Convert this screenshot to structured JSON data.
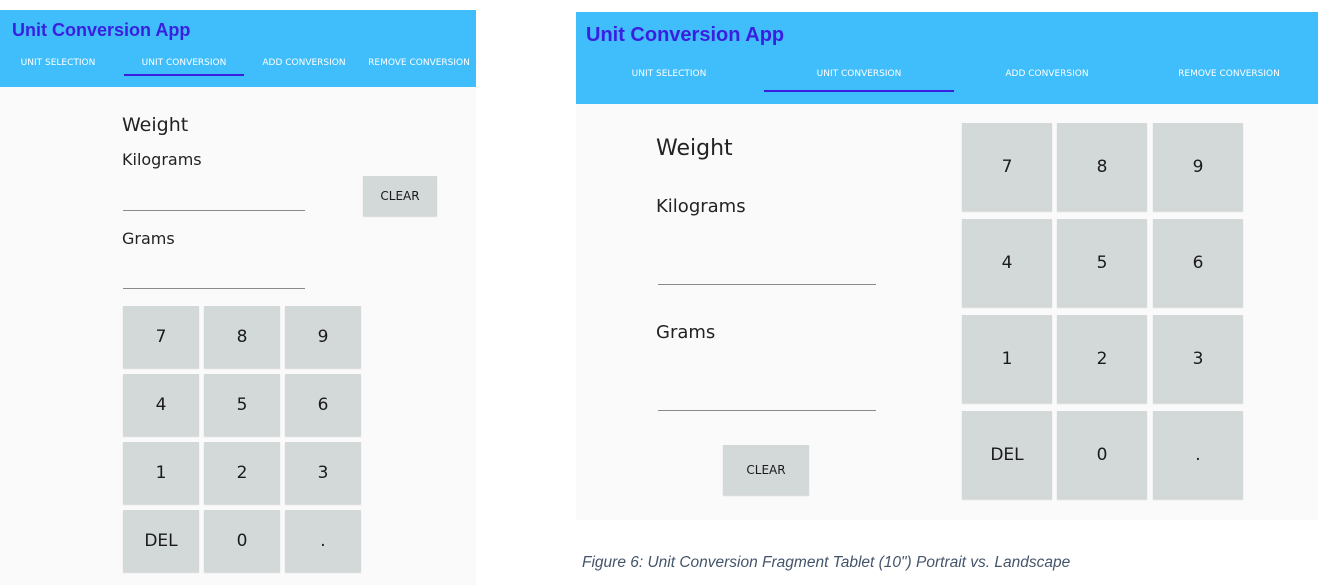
{
  "colors": {
    "appbar": "#40bdfb",
    "title": "#3a1fe0",
    "indicator": "#3a1fe0",
    "button": "#d3d8d9"
  },
  "app": {
    "title": "Unit Conversion App"
  },
  "tabs": [
    {
      "label": "UNIT SELECTION"
    },
    {
      "label": "UNIT CONVERSION",
      "selected": true
    },
    {
      "label": "ADD CONVERSION"
    },
    {
      "label": "REMOVE CONVERSION"
    }
  ],
  "conversion": {
    "category": "Weight",
    "from_unit": "Kilograms",
    "to_unit": "Grams",
    "from_value": "",
    "to_value": "",
    "clear_label": "CLEAR"
  },
  "keypad": [
    "7",
    "8",
    "9",
    "4",
    "5",
    "6",
    "1",
    "2",
    "3",
    "DEL",
    "0",
    "."
  ],
  "caption": "Figure 6: Unit Conversion Fragment Tablet (10\") Portrait vs. Landscape"
}
